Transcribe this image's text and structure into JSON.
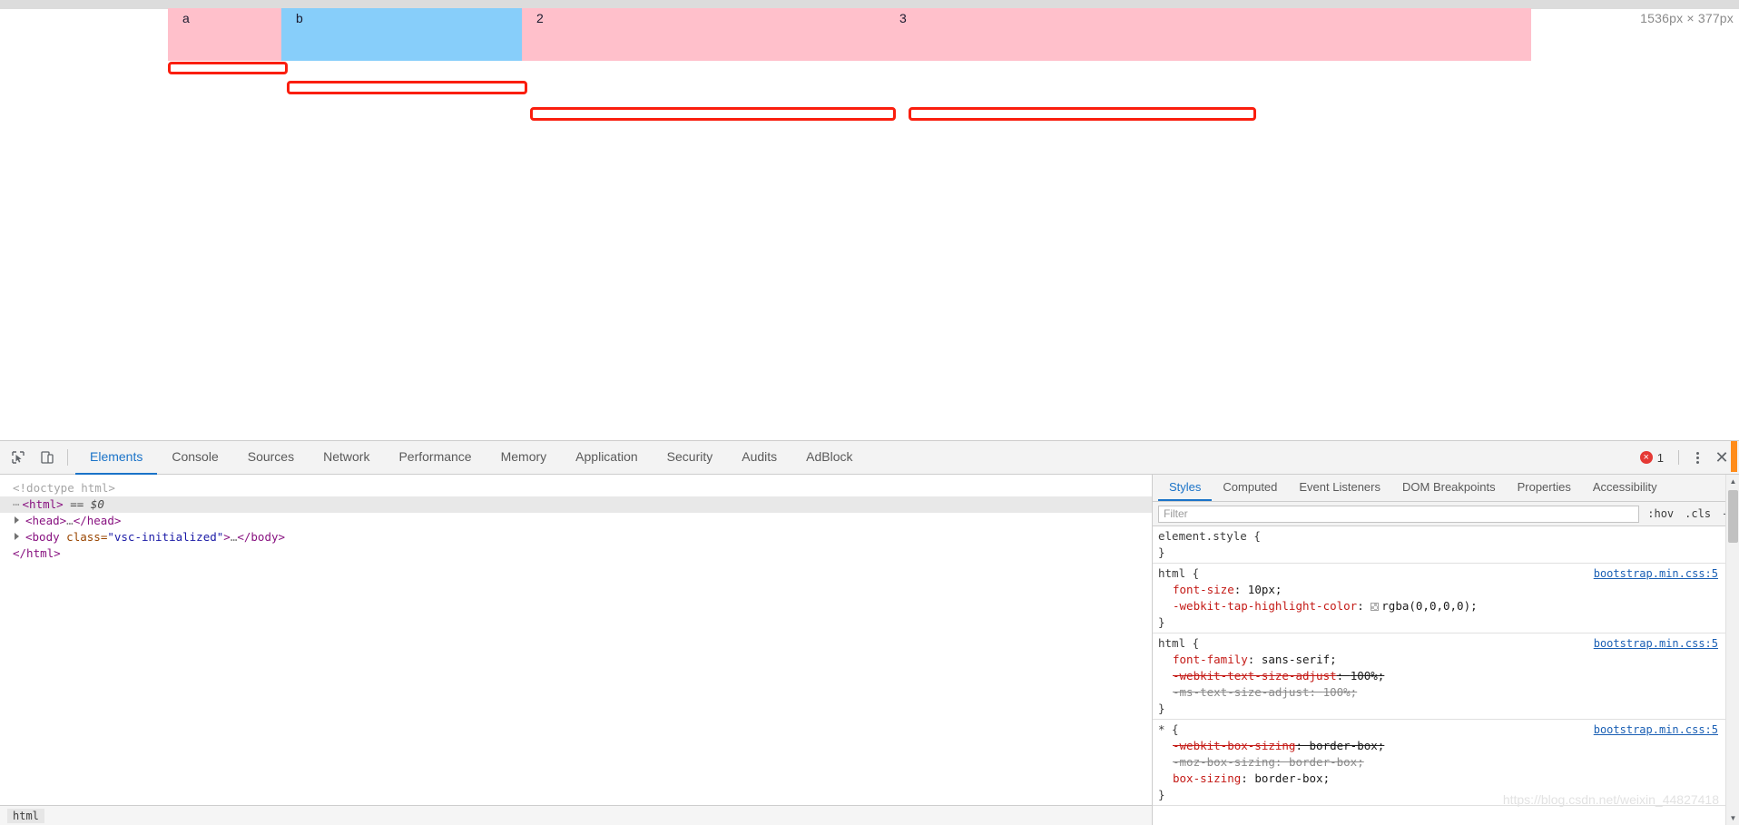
{
  "page": {
    "dimension_badge": "1536px × 377px",
    "flex_cells": [
      {
        "label": "a",
        "color": "#ffc0cb"
      },
      {
        "label": "b",
        "color": "#87cefa"
      },
      {
        "label": "2",
        "color": "#ffc0cb"
      },
      {
        "label": "3",
        "color": "#ffc0cb"
      }
    ],
    "annotation_color": "#fa1e0e",
    "annotation_count": 4
  },
  "devtools": {
    "toolbar": {
      "inspect_icon": "inspect-cursor-icon",
      "device_icon": "device-toolbar-icon",
      "tabs": [
        {
          "label": "Elements",
          "active": true
        },
        {
          "label": "Console",
          "active": false
        },
        {
          "label": "Sources",
          "active": false
        },
        {
          "label": "Network",
          "active": false
        },
        {
          "label": "Performance",
          "active": false
        },
        {
          "label": "Memory",
          "active": false
        },
        {
          "label": "Application",
          "active": false
        },
        {
          "label": "Security",
          "active": false
        },
        {
          "label": "Audits",
          "active": false
        },
        {
          "label": "AdBlock",
          "active": false
        }
      ],
      "error_count": "1",
      "error_color": "#e53935",
      "more_icon": "kebab-menu-icon",
      "close_icon": "close-icon"
    },
    "dom": {
      "lines": [
        {
          "kind": "doctype",
          "text": "<!doctype html>"
        },
        {
          "kind": "html_selected",
          "tag": "<html>",
          "marker": "== $0"
        },
        {
          "kind": "element",
          "tag_open": "<head>",
          "ellipsis": "…",
          "tag_close": "</head>"
        },
        {
          "kind": "element_attr",
          "tag_open": "<body",
          "attr": "class",
          "value": "\"vsc-initialized\"",
          "gt": ">",
          "ellipsis": "…",
          "tag_close": "</body>"
        },
        {
          "kind": "close",
          "text": "</html>"
        }
      ],
      "breadcrumb": [
        "html"
      ]
    },
    "styles": {
      "tabs": [
        {
          "label": "Styles",
          "active": true
        },
        {
          "label": "Computed",
          "active": false
        },
        {
          "label": "Event Listeners",
          "active": false
        },
        {
          "label": "DOM Breakpoints",
          "active": false
        },
        {
          "label": "Properties",
          "active": false
        },
        {
          "label": "Accessibility",
          "active": false
        }
      ],
      "filter_placeholder": "Filter",
      "filter_value": "",
      "hov_label": ":hov",
      "cls_label": ".cls",
      "add_label": "+",
      "rules": [
        {
          "selector": "element.style {",
          "origin": "",
          "declarations": [],
          "close": "}"
        },
        {
          "selector": "html {",
          "origin": "bootstrap.min.css:5",
          "declarations": [
            {
              "prop": "font-size",
              "value": "10px;",
              "disabled": false,
              "swatch": false
            },
            {
              "prop": "-webkit-tap-highlight-color",
              "value": "rgba(0,0,0,0);",
              "disabled": false,
              "swatch": true
            }
          ],
          "close": "}"
        },
        {
          "selector": "html {",
          "origin": "bootstrap.min.css:5",
          "declarations": [
            {
              "prop": "font-family",
              "value": "sans-serif;",
              "disabled": false,
              "swatch": false
            },
            {
              "prop": "-webkit-text-size-adjust",
              "value": "100%;",
              "disabled": true,
              "swatch": false
            },
            {
              "prop": "-ms-text-size-adjust",
              "value": "100%;",
              "disabled": true,
              "gray": true,
              "swatch": false
            }
          ],
          "close": "}"
        },
        {
          "selector": "* {",
          "origin": "bootstrap.min.css:5",
          "declarations": [
            {
              "prop": "-webkit-box-sizing",
              "value": "border-box;",
              "disabled": true,
              "swatch": false
            },
            {
              "prop": "-moz-box-sizing",
              "value": "border-box;",
              "disabled": true,
              "gray": true,
              "swatch": false
            },
            {
              "prop": "box-sizing",
              "value": "border-box;",
              "disabled": false,
              "swatch": false
            }
          ],
          "close": "}"
        }
      ]
    }
  },
  "watermark": "https://blog.csdn.net/weixin_44827418"
}
